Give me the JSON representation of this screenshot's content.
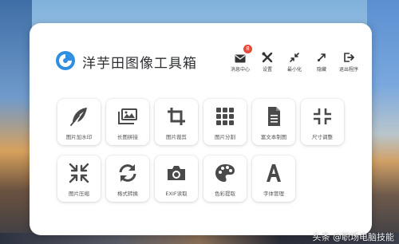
{
  "app": {
    "title": "洋芋田图像工具箱",
    "logo_icon": "app-logo-icon",
    "accent": "#2f8ee0"
  },
  "toolbar": {
    "items": [
      {
        "label": "消息中心",
        "icon": "mail-icon",
        "badge": "8"
      },
      {
        "label": "设置",
        "icon": "tools-icon"
      },
      {
        "label": "最小化",
        "icon": "minimize-icon"
      },
      {
        "label": "隐藏",
        "icon": "hide-icon"
      },
      {
        "label": "退出程序",
        "icon": "exit-icon"
      }
    ]
  },
  "tools": [
    {
      "label": "图片加水印",
      "icon": "feather-icon"
    },
    {
      "label": "长图拼接",
      "icon": "images-icon"
    },
    {
      "label": "图片裁剪",
      "icon": "crop-icon"
    },
    {
      "label": "图片分割",
      "icon": "grid-icon"
    },
    {
      "label": "富文本制图",
      "icon": "document-icon"
    },
    {
      "label": "尺寸调整",
      "icon": "compress-icon"
    },
    {
      "label": "图片压缩",
      "icon": "shrink-icon"
    },
    {
      "label": "格式转换",
      "icon": "sync-icon"
    },
    {
      "label": "EXIF读取",
      "icon": "camera-icon"
    },
    {
      "label": "色彩提取",
      "icon": "palette-icon"
    },
    {
      "label": "字体管理",
      "icon": "font-icon"
    }
  ],
  "watermark": "头条 @职场电脑技能"
}
